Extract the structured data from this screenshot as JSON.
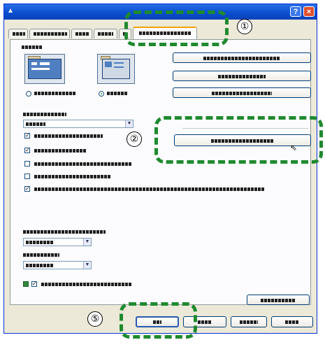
{
  "window": {
    "title": "",
    "help_label": "?",
    "close_label": "×"
  },
  "markers": [
    "①",
    "②",
    "⑤"
  ],
  "footer": {
    "code": ""
  },
  "colors": {
    "callout": "#1f8a2f",
    "titlebar": "#0a4fd0",
    "tab_highlight": "#f5a300"
  }
}
